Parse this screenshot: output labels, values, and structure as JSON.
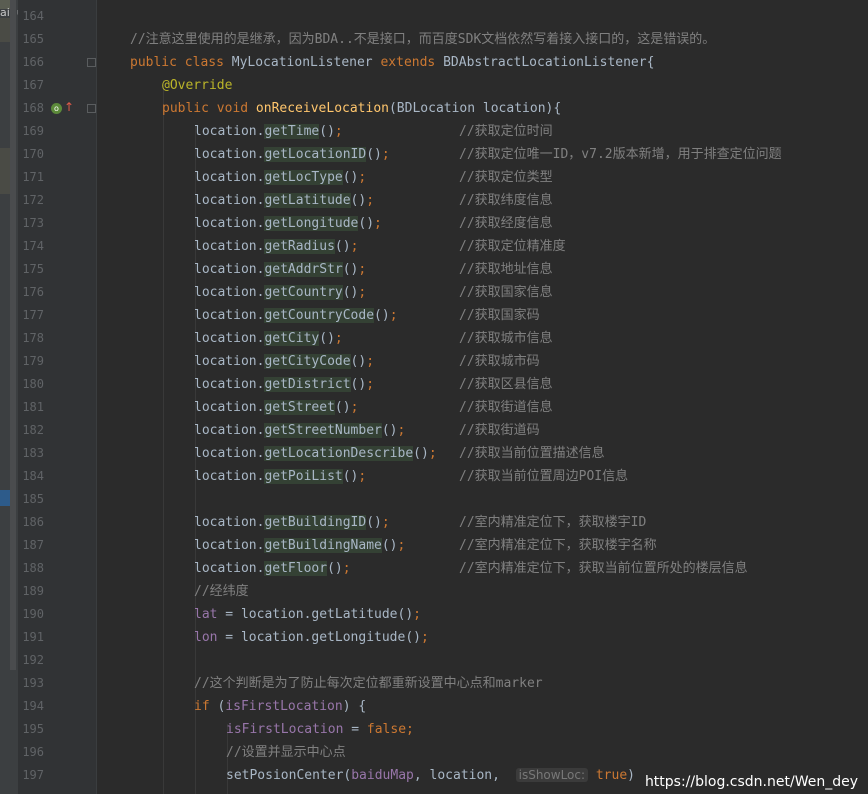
{
  "sidebar": {
    "label": "aidu"
  },
  "watermark": "https://blog.csdn.net/Wen_dey",
  "lines": [
    {
      "n": "164"
    },
    {
      "n": "165",
      "comment": "//注意这里使用的是继承，因为BDA..不是接口，而百度SDK文档依然写着接入接口的，这是错误的。"
    },
    {
      "n": "166",
      "kw1": "public class",
      "cls": "MyLocationListener",
      "kw2": "extends",
      "base": "BDAbstractLocationListener{"
    },
    {
      "n": "167",
      "ann": "@Override"
    },
    {
      "n": "168",
      "kw1": "public void",
      "fn": "onReceiveLocation",
      "rest": "(BDLocation location){"
    },
    {
      "n": "169",
      "obj": "location.",
      "call": "getTime",
      "paren": "()",
      "semi": ";",
      "cmt": "//获取定位时间"
    },
    {
      "n": "170",
      "obj": "location.",
      "call": "getLocationID",
      "paren": "()",
      "semi": ";",
      "cmt": "//获取定位唯一ID，v7.2版本新增，用于排查定位问题"
    },
    {
      "n": "171",
      "obj": "location.",
      "call": "getLocType",
      "paren": "()",
      "semi": ";",
      "cmt": "//获取定位类型"
    },
    {
      "n": "172",
      "obj": "location.",
      "call": "getLatitude",
      "paren": "()",
      "semi": ";",
      "cmt": "//获取纬度信息"
    },
    {
      "n": "173",
      "obj": "location.",
      "call": "getLongitude",
      "paren": "()",
      "semi": ";",
      "cmt": "//获取经度信息"
    },
    {
      "n": "174",
      "obj": "location.",
      "call": "getRadius",
      "paren": "()",
      "semi": ";",
      "cmt": "//获取定位精准度"
    },
    {
      "n": "175",
      "obj": "location.",
      "call": "getAddrStr",
      "paren": "()",
      "semi": ";",
      "cmt": "//获取地址信息"
    },
    {
      "n": "176",
      "obj": "location.",
      "call": "getCountry",
      "paren": "()",
      "semi": ";",
      "cmt": "//获取国家信息"
    },
    {
      "n": "177",
      "obj": "location.",
      "call": "getCountryCode",
      "paren": "()",
      "semi": ";",
      "cmt": "//获取国家码"
    },
    {
      "n": "178",
      "obj": "location.",
      "call": "getCity",
      "paren": "()",
      "semi": ";",
      "cmt": "//获取城市信息"
    },
    {
      "n": "179",
      "obj": "location.",
      "call": "getCityCode",
      "paren": "()",
      "semi": ";",
      "cmt": "//获取城市码"
    },
    {
      "n": "180",
      "obj": "location.",
      "call": "getDistrict",
      "paren": "()",
      "semi": ";",
      "cmt": "//获取区县信息"
    },
    {
      "n": "181",
      "obj": "location.",
      "call": "getStreet",
      "paren": "()",
      "semi": ";",
      "cmt": "//获取街道信息"
    },
    {
      "n": "182",
      "obj": "location.",
      "call": "getStreetNumber",
      "paren": "()",
      "semi": ";",
      "cmt": "//获取街道码"
    },
    {
      "n": "183",
      "obj": "location.",
      "call": "getLocationDescribe",
      "paren": "()",
      "semi": ";",
      "cmt": "//获取当前位置描述信息"
    },
    {
      "n": "184",
      "obj": "location.",
      "call": "getPoiList",
      "paren": "()",
      "semi": ";",
      "cmt": "//获取当前位置周边POI信息"
    },
    {
      "n": "185"
    },
    {
      "n": "186",
      "obj": "location.",
      "call": "getBuildingID",
      "paren": "()",
      "semi": ";",
      "cmt": "//室内精准定位下，获取楼宇ID"
    },
    {
      "n": "187",
      "obj": "location.",
      "call": "getBuildingName",
      "paren": "()",
      "semi": ";",
      "cmt": "//室内精准定位下，获取楼宇名称"
    },
    {
      "n": "188",
      "obj": "location.",
      "call": "getFloor",
      "paren": "()",
      "semi": ";",
      "cmt": "//室内精准定位下，获取当前位置所处的楼层信息"
    },
    {
      "n": "189",
      "comment": "//经纬度"
    },
    {
      "n": "190",
      "fld": "lat",
      "rest": " = location.getLatitude()",
      "semi": ";"
    },
    {
      "n": "191",
      "fld": "lon",
      "rest": " = location.getLongitude()",
      "semi": ";"
    },
    {
      "n": "192"
    },
    {
      "n": "193",
      "comment": "//这个判断是为了防止每次定位都重新设置中心点和marker"
    },
    {
      "n": "194",
      "kw1": "if",
      "rest": " (",
      "fld": "isFirstLocation",
      "rest2": ") {"
    },
    {
      "n": "195",
      "fld": "isFirstLocation",
      "rest": " = ",
      "kw2": "false",
      "semi": ";"
    },
    {
      "n": "196",
      "comment": "//设置并显示中心点"
    },
    {
      "n": "197",
      "rest": "setPosionCenter(",
      "fld": "baiduMap",
      "rest2": ", location, ",
      "hint": "isShowLoc:",
      "kw2": "true",
      "rest3": ")"
    }
  ]
}
